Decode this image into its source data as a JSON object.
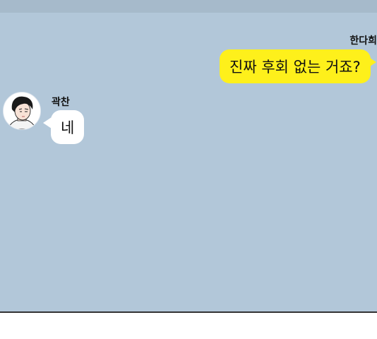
{
  "chat": {
    "messages": [
      {
        "sender": "한다희",
        "text": "진짜 후회 없는 거죠?",
        "side": "right"
      },
      {
        "sender": "곽찬",
        "text": "네",
        "side": "left"
      }
    ]
  },
  "colors": {
    "background": "#b2c7d9",
    "my_bubble": "#fef01b",
    "their_bubble": "#ffffff"
  },
  "icons": {
    "avatar": "person-portrait-icon"
  }
}
